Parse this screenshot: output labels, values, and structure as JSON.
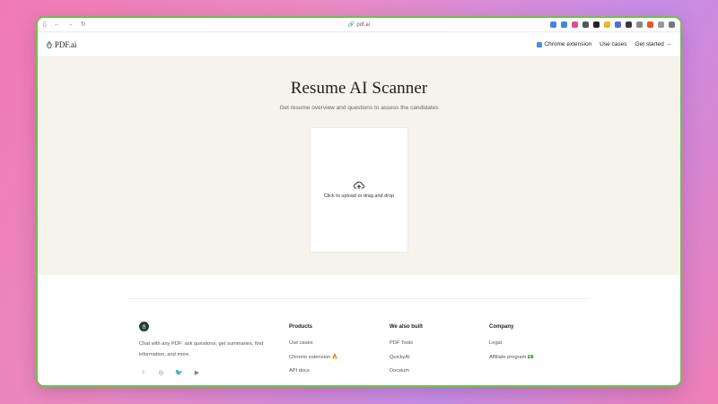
{
  "browser": {
    "url": "pdf.ai",
    "nav_icons": [
      "sidebar-icon",
      "back-arrow-icon",
      "forward-arrow-icon",
      "reload-icon"
    ],
    "extension_colors": [
      "#4a7ee8",
      "#3f8bd9",
      "#e04b8e",
      "#555555",
      "#222222",
      "#e7b829",
      "#4c6fd1",
      "#3a3a3a",
      "#888888",
      "#e2582b",
      "#999999",
      "#777777"
    ]
  },
  "header": {
    "logo_text": "PDF.ai",
    "nav": {
      "chrome_extension": "Chrome extension",
      "use_cases": "Use cases",
      "get_started": "Get started →"
    }
  },
  "hero": {
    "title": "Resume AI Scanner",
    "subtitle": "Get resume overview and questions to assess the candidates",
    "upload_text": "Click to upload or drag and drop"
  },
  "footer": {
    "description": "Chat with any PDF: ask questions, get summaries, find information, and more.",
    "products": {
      "heading": "Products",
      "links": [
        "Use cases",
        "Chrome extension 🔥",
        "API docs"
      ]
    },
    "also_built": {
      "heading": "We also built",
      "links": [
        "PDF Tools",
        "QuickyAI",
        "Docsium"
      ]
    },
    "company": {
      "heading": "Company",
      "links": [
        "Legal",
        "Affiliate program 💵"
      ]
    },
    "socials": [
      "tiktok-icon",
      "instagram-icon",
      "twitter-icon",
      "youtube-icon"
    ]
  }
}
